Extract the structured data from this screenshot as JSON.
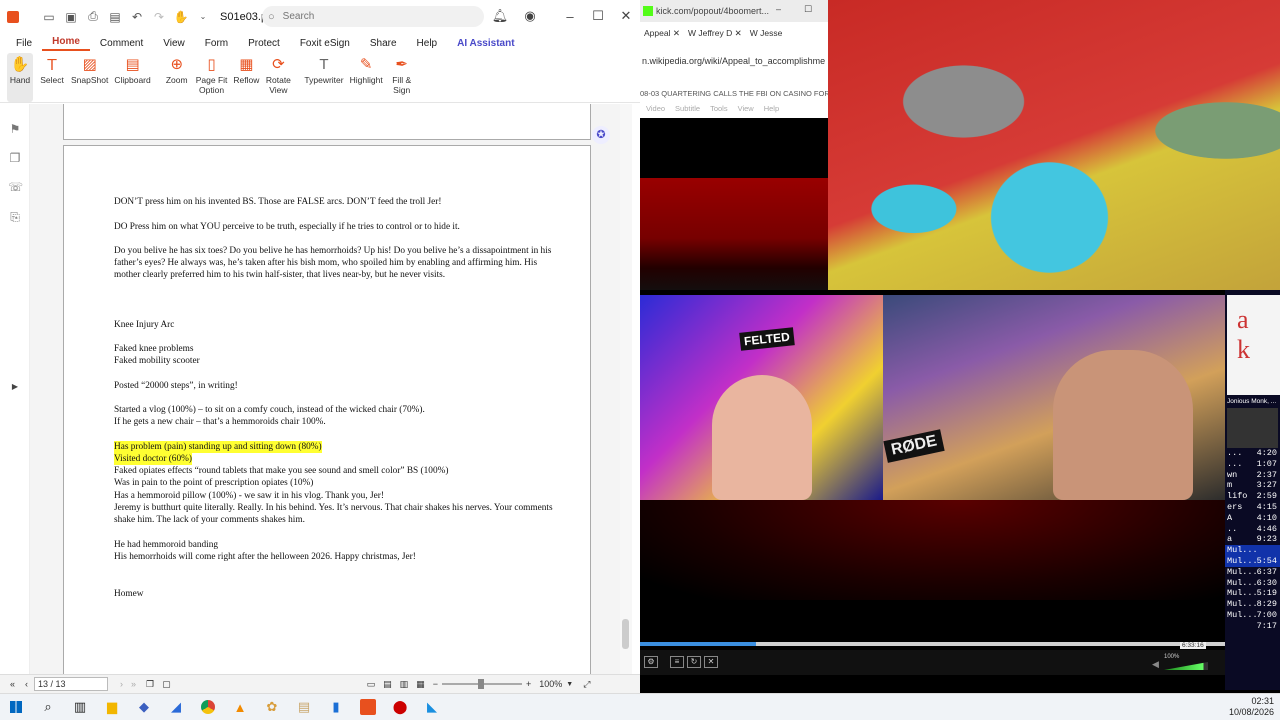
{
  "foxit": {
    "doc_title": "S01e03.pdf *",
    "search_placeholder": "Search",
    "menus": [
      "File",
      "Home",
      "Comment",
      "View",
      "Form",
      "Protect",
      "Foxit eSign",
      "Share",
      "Help",
      "AI Assistant"
    ],
    "ribbon": [
      {
        "label": "Hand",
        "icon": "hand-icon"
      },
      {
        "label": "Select",
        "icon": "select-icon"
      },
      {
        "label": "SnapShot",
        "icon": "snapshot-icon"
      },
      {
        "label": "Clipboard",
        "icon": "clipboard-icon"
      },
      {
        "label": "Zoom",
        "icon": "zoom-icon"
      },
      {
        "label": "Page Fit\nOption",
        "icon": "page-fit-icon"
      },
      {
        "label": "Reflow",
        "icon": "reflow-icon"
      },
      {
        "label": "Rotate\nView",
        "icon": "rotate-icon"
      },
      {
        "label": "Typewriter",
        "icon": "typewriter-icon"
      },
      {
        "label": "Highlight",
        "icon": "highlight-icon"
      },
      {
        "label": "Fill &\nSign",
        "icon": "fill-sign-icon"
      }
    ],
    "page_text": [
      "DON’T press him on his invented BS. Those are FALSE arcs. DON’T feed the troll Jer!",
      "DO Press him on what YOU perceive to be truth, especially if he tries to control or to hide it.",
      "Do you belive he has six toes? Do you belive he has hemorrhoids? Up his! Do you belive he’s a dissapointment in his father’s eyes? He always was, he’s taken after his bish mom, who spoiled him by enabling and affirming him. His mother clearly preferred him to his twin half-sister, that lives near-by, but he never visits.",
      "Knee Injury Arc",
      "Faked knee problems",
      "Faked mobility scooter",
      "Posted “20000 steps”, in writing!",
      "Started a vlog (100%) – to sit on a comfy couch, instead of the wicked chair (70%).",
      "If he gets a new chair – that’s a hemmoroids chair 100%.",
      "Has problem (pain) standing up and sitting down (80%)",
      "Visited doctor (60%)",
      "Faked opiates effects “round tablets that make you see sound and smell color” BS (100%)",
      "Was in pain to the point of prescription opiates (10%)",
      "Has a hemmoroid pillow (100%) - we saw it in his vlog. Thank you, Jer!",
      "Jeremy is butthurt quite literally. Really. In his behind. Yes. It’s nervous. That chair shakes his nerves. Your comments shake him. The lack of your comments shakes him.",
      "He had hemmoroid banding",
      "His hemorrhoids will come right after the helloween 2026. Happy christmas, Jer!",
      "Homew"
    ],
    "page_indicator": "13 / 13",
    "zoom": "100%"
  },
  "browser": {
    "title_url": "kick.com/popout/4boomert...",
    "tabs": [
      "Appeal",
      "Jeffrey D",
      "Jesse"
    ],
    "address": "n.wikipedia.org/wiki/Appeal_to_accomplishme",
    "video_title": "08-03 QUARTERING CALLS THE FBI ON CASINO FOR",
    "video_menu": [
      "Video",
      "Subtitle",
      "Tools",
      "View",
      "Help"
    ]
  },
  "stream": {
    "sign1": "FELTED",
    "mic_brand": "RØDE",
    "elapsed": "6:33:16",
    "volume": "100%",
    "sidebar_header": "Jonious Monk, ...",
    "playlist": [
      {
        "name": "...",
        "time": "4:20",
        "active": false
      },
      {
        "name": "...",
        "time": "1:07",
        "active": false
      },
      {
        "name": "wn",
        "time": "2:37",
        "active": false
      },
      {
        "name": "m",
        "time": "3:27",
        "active": false
      },
      {
        "name": "lifo",
        "time": "2:59",
        "active": false
      },
      {
        "name": "ers",
        "time": "4:15",
        "active": false
      },
      {
        "name": "A",
        "time": "4:10",
        "active": false
      },
      {
        "name": "..",
        "time": "4:46",
        "active": false
      },
      {
        "name": "a",
        "time": "9:23",
        "active": false
      },
      {
        "name": "Mul...",
        "time": "5:54",
        "active": true
      },
      {
        "name": "Mul...",
        "time": "6:37",
        "active": true
      },
      {
        "name": "Mul...",
        "time": "6:30",
        "active": false
      },
      {
        "name": "Mul...",
        "time": "5:19",
        "active": false
      },
      {
        "name": "Mul...",
        "time": "8:29",
        "active": false
      },
      {
        "name": "Mul...",
        "time": "7:00",
        "active": false
      },
      {
        "name": "Mul...",
        "time": "7:17",
        "active": false
      }
    ]
  },
  "taskbar": {
    "time": "02:31",
    "date": "10/08/2026"
  },
  "colors": {
    "accent": "#e8501e",
    "highlight": "#ffff32",
    "ai": "#4a4ac9"
  }
}
